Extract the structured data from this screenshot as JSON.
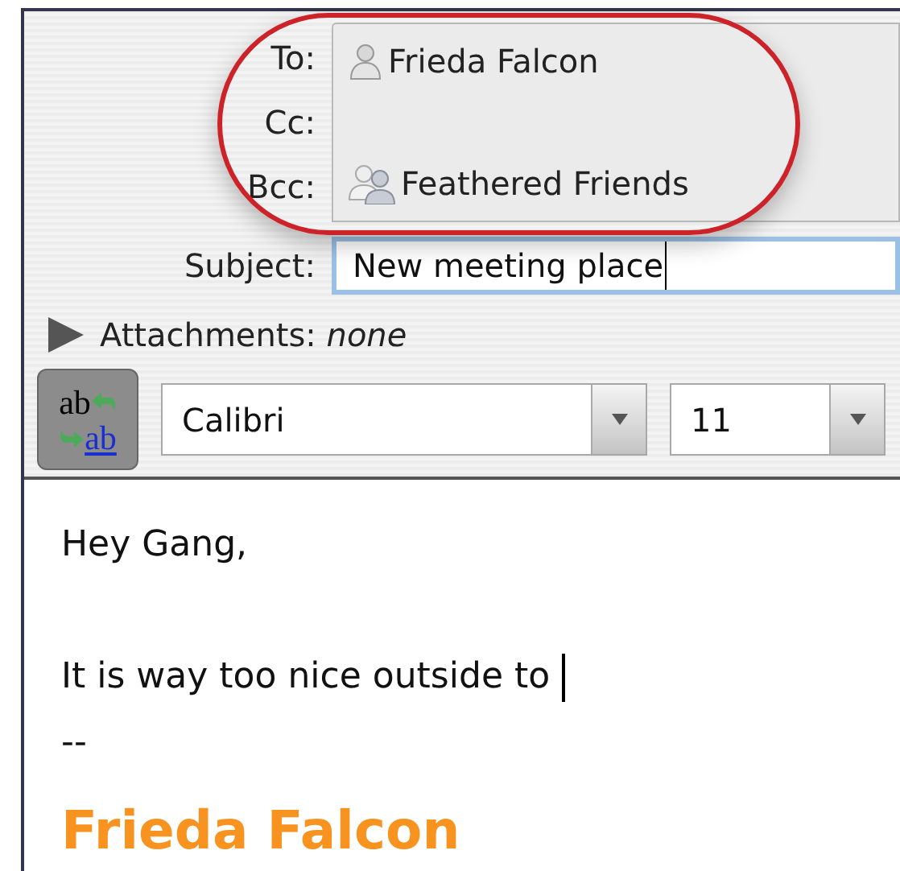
{
  "recipients": [
    {
      "label": "To:",
      "entries": [
        {
          "kind": "person",
          "name": "Frieda Falcon"
        }
      ]
    },
    {
      "label": "Cc:"
    },
    {
      "label": "Bcc:",
      "entries": [
        {
          "kind": "group",
          "name": "Feathered Friends"
        }
      ]
    }
  ],
  "subject": {
    "label": "Subject:",
    "value": "New meeting place",
    "focused": true
  },
  "attachments": {
    "label": "Attachments:",
    "value": "none",
    "expanded": false
  },
  "toolbar": {
    "format_toggle": {
      "top": "ab",
      "bottom": "ab",
      "on": true
    },
    "font": {
      "value": "Calibri"
    },
    "size": {
      "value": "11"
    }
  },
  "body": {
    "lines": [
      {
        "kind": "text",
        "text": "Hey Gang,"
      },
      {
        "kind": "blank"
      },
      {
        "kind": "text",
        "text": "It is way too nice outside to ",
        "caret": true
      },
      {
        "kind": "text",
        "text": "--"
      },
      {
        "kind": "signature",
        "text": "Frieda Falcon",
        "color": "#f7931e"
      }
    ]
  },
  "annotation": {
    "kind": "oval",
    "color": "#cc2229"
  }
}
